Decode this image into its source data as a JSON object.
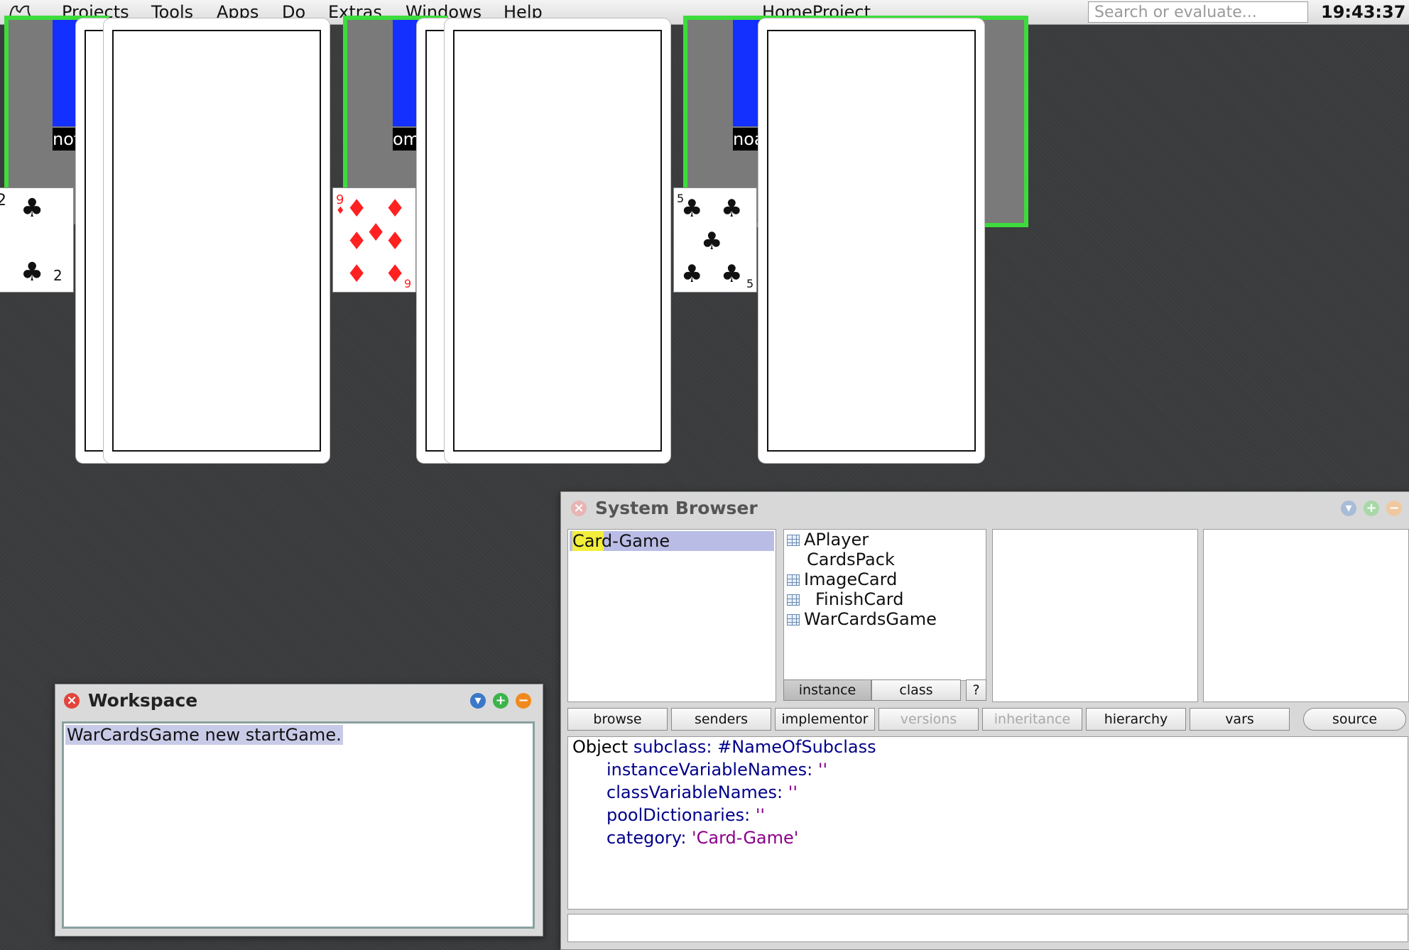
{
  "menubar": {
    "items": [
      "Projects",
      "Tools",
      "Apps",
      "Do",
      "Extras",
      "Windows",
      "Help"
    ],
    "project_title": "HomeProject",
    "search_placeholder": "Search or evaluate...",
    "clock": "19:43:37"
  },
  "game": {
    "players": [
      {
        "name": "nof",
        "card": {
          "rank": "2",
          "suit": "clubs"
        }
      },
      {
        "name": "om",
        "card": {
          "rank": "9",
          "suit": "diamonds"
        }
      },
      {
        "name": "noa",
        "card": {
          "rank": "5",
          "suit": "clubs"
        }
      }
    ],
    "colors": {
      "panel": "#7a7a7a",
      "highlight": "#3cdc3c",
      "avatar": "#1430ff",
      "red_suit": "#ff2020"
    }
  },
  "system_browser": {
    "title": "System Browser",
    "categories": [
      "Card-Game"
    ],
    "selected_category": "Card-Game",
    "search_highlight": "Car",
    "classes": [
      {
        "name": "APlayer",
        "icon": "class-icon",
        "indent": 0
      },
      {
        "name": "CardsPack",
        "icon": "",
        "indent": 0
      },
      {
        "name": "ImageCard",
        "icon": "class-icon",
        "indent": 0
      },
      {
        "name": "FinishCard",
        "icon": "class-icon",
        "indent": 1
      },
      {
        "name": "WarCardsGame",
        "icon": "class-icon",
        "indent": 0
      }
    ],
    "toggle": {
      "instance": "instance",
      "class": "class",
      "help": "?"
    },
    "buttons": [
      "browse",
      "senders",
      "implementor",
      "versions",
      "inheritance",
      "hierarchy",
      "vars",
      "source"
    ],
    "disabled_buttons": [
      "versions",
      "inheritance"
    ],
    "code": {
      "line1_receiver": "Object",
      "line1_keyword": "subclass:",
      "line1_arg": "#NameOfSubclass",
      "line2_keyword": "instanceVariableNames:",
      "line2_value": "''",
      "line3_keyword": "classVariableNames:",
      "line3_value": "''",
      "line4_keyword": "poolDictionaries:",
      "line4_value": "''",
      "line5_keyword": "category:",
      "line5_value": "'Card-Game'"
    }
  },
  "workspace": {
    "title": "Workspace",
    "content": "WarCardsGame new startGame."
  }
}
